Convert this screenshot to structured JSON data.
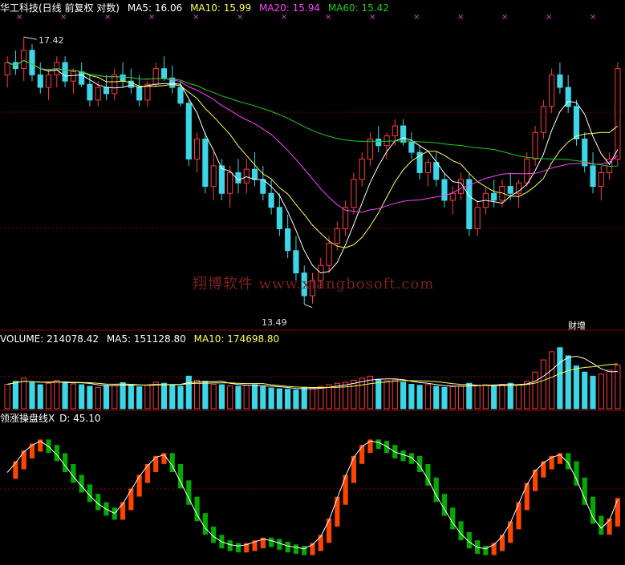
{
  "header": {
    "stock_label": "华工科技(日线 前复权 对数)",
    "ma5": "MA5: 16.06",
    "ma10": "MA10: 15.99",
    "ma20": "MA20: 15.94",
    "ma60": "MA60: 15.42"
  },
  "price_annotations": {
    "high": "17.42",
    "low": "13.49",
    "event_tag": "财增"
  },
  "volume_header": {
    "volume": "VOLUME: 214078.42",
    "ma5": "MA5: 151128.80",
    "ma10": "MA10: 174698.80"
  },
  "indicator_header": {
    "name": "领涨操盘线X",
    "d": "D: 45.10"
  },
  "watermark": "翔博软件 www.xiangbosoft.com",
  "colors": {
    "up": "#ff3c3c",
    "down": "#3cd6e6",
    "ma5": "#ffffff",
    "ma10": "#ffff55",
    "ma20": "#ff44ff",
    "ma60": "#22cc22",
    "grid": "#8b0000",
    "marker": "#dd44dd",
    "osc_up": "#ff4400",
    "osc_down": "#00aa00",
    "osc_line": "#ffffff"
  },
  "chart_data": [
    {
      "type": "candlestick",
      "title": "华工科技(日线 前复权 对数)",
      "scale": "log",
      "y_range": [
        13.2,
        17.8
      ],
      "candles": [
        [
          16.8,
          17.1,
          16.6,
          17.0
        ],
        [
          17.0,
          17.2,
          16.8,
          16.9
        ],
        [
          16.9,
          17.42,
          16.7,
          17.2
        ],
        [
          17.2,
          17.3,
          16.7,
          16.8
        ],
        [
          16.8,
          17.0,
          16.5,
          16.6
        ],
        [
          16.6,
          16.9,
          16.4,
          16.8
        ],
        [
          16.8,
          17.1,
          16.6,
          17.0
        ],
        [
          17.0,
          17.1,
          16.6,
          16.7
        ],
        [
          16.7,
          16.9,
          16.5,
          16.85
        ],
        [
          16.85,
          17.0,
          16.6,
          16.65
        ],
        [
          16.65,
          16.8,
          16.3,
          16.4
        ],
        [
          16.4,
          16.7,
          16.3,
          16.6
        ],
        [
          16.6,
          16.8,
          16.4,
          16.5
        ],
        [
          16.5,
          16.9,
          16.4,
          16.8
        ],
        [
          16.8,
          17.0,
          16.6,
          16.7
        ],
        [
          16.7,
          16.9,
          16.5,
          16.6
        ],
        [
          16.6,
          16.8,
          16.3,
          16.4
        ],
        [
          16.4,
          16.7,
          16.3,
          16.65
        ],
        [
          16.65,
          17.0,
          16.6,
          16.9
        ],
        [
          16.9,
          17.1,
          16.7,
          16.75
        ],
        [
          16.75,
          16.95,
          16.5,
          16.6
        ],
        [
          16.6,
          16.7,
          16.3,
          16.35
        ],
        [
          16.35,
          16.4,
          15.4,
          15.5
        ],
        [
          15.5,
          15.9,
          15.3,
          15.8
        ],
        [
          15.8,
          15.9,
          15.0,
          15.1
        ],
        [
          15.1,
          15.6,
          14.9,
          15.4
        ],
        [
          15.4,
          15.5,
          14.9,
          15.0
        ],
        [
          15.0,
          15.4,
          14.8,
          15.3
        ],
        [
          15.3,
          15.5,
          15.0,
          15.15
        ],
        [
          15.15,
          15.5,
          15.0,
          15.35
        ],
        [
          15.35,
          15.6,
          15.1,
          15.2
        ],
        [
          15.2,
          15.4,
          14.9,
          15.0
        ],
        [
          15.0,
          15.2,
          14.7,
          14.8
        ],
        [
          14.8,
          15.0,
          14.4,
          14.5
        ],
        [
          14.5,
          14.7,
          14.1,
          14.2
        ],
        [
          14.2,
          14.4,
          13.8,
          13.9
        ],
        [
          13.9,
          14.0,
          13.49,
          13.6
        ],
        [
          13.6,
          13.9,
          13.5,
          13.8
        ],
        [
          13.8,
          14.1,
          13.7,
          14.0
        ],
        [
          14.0,
          14.4,
          13.9,
          14.3
        ],
        [
          14.3,
          14.6,
          14.2,
          14.5
        ],
        [
          14.5,
          14.9,
          14.4,
          14.8
        ],
        [
          14.8,
          15.3,
          14.7,
          15.2
        ],
        [
          15.2,
          15.6,
          15.1,
          15.5
        ],
        [
          15.5,
          15.9,
          15.4,
          15.8
        ],
        [
          15.8,
          16.0,
          15.6,
          15.7
        ],
        [
          15.7,
          15.9,
          15.5,
          15.85
        ],
        [
          15.85,
          16.1,
          15.7,
          16.0
        ],
        [
          16.0,
          16.1,
          15.7,
          15.75
        ],
        [
          15.75,
          15.9,
          15.5,
          15.6
        ],
        [
          15.6,
          15.7,
          15.2,
          15.3
        ],
        [
          15.3,
          15.5,
          15.1,
          15.45
        ],
        [
          15.45,
          15.6,
          15.1,
          15.2
        ],
        [
          15.2,
          15.3,
          14.8,
          14.9
        ],
        [
          14.9,
          15.1,
          14.7,
          15.0
        ],
        [
          15.0,
          15.3,
          14.9,
          15.2
        ],
        [
          15.2,
          15.3,
          14.4,
          14.5
        ],
        [
          14.5,
          14.9,
          14.4,
          14.8
        ],
        [
          14.8,
          15.1,
          14.7,
          15.0
        ],
        [
          15.0,
          15.2,
          14.8,
          14.9
        ],
        [
          14.9,
          15.2,
          14.8,
          15.1
        ],
        [
          15.1,
          15.3,
          14.9,
          15.0
        ],
        [
          15.0,
          15.2,
          14.8,
          15.15
        ],
        [
          15.15,
          15.6,
          15.1,
          15.5
        ],
        [
          15.5,
          16.0,
          15.4,
          15.9
        ],
        [
          15.9,
          16.4,
          15.8,
          16.3
        ],
        [
          16.3,
          16.9,
          16.2,
          16.8
        ],
        [
          16.8,
          17.0,
          16.5,
          16.6
        ],
        [
          16.6,
          16.8,
          16.2,
          16.3
        ],
        [
          16.3,
          16.4,
          15.7,
          15.8
        ],
        [
          15.8,
          15.9,
          15.3,
          15.4
        ],
        [
          15.4,
          15.6,
          15.0,
          15.1
        ],
        [
          15.1,
          15.4,
          14.9,
          15.3
        ],
        [
          15.3,
          15.6,
          15.2,
          15.5
        ],
        [
          15.5,
          17.0,
          15.4,
          16.9
        ]
      ]
    },
    {
      "type": "bar",
      "title": "VOLUME",
      "values": [
        120000,
        135000,
        150000,
        128000,
        118000,
        125000,
        140000,
        132000,
        122000,
        118000,
        110000,
        105000,
        115000,
        120000,
        128000,
        112000,
        108000,
        116000,
        130000,
        125000,
        118000,
        110000,
        160000,
        140000,
        135000,
        120000,
        118000,
        112000,
        110000,
        115000,
        118000,
        108000,
        102000,
        98000,
        96000,
        92000,
        105000,
        100000,
        110000,
        118000,
        125000,
        130000,
        140000,
        150000,
        160000,
        145000,
        138000,
        142000,
        130000,
        120000,
        115000,
        118000,
        110000,
        105000,
        108000,
        112000,
        125000,
        115000,
        118000,
        112000,
        120000,
        125000,
        118000,
        135000,
        180000,
        240000,
        280000,
        300000,
        260000,
        210000,
        180000,
        160000,
        170000,
        190000,
        214078.42
      ],
      "up": [
        true,
        false,
        true,
        false,
        false,
        true,
        true,
        false,
        true,
        false,
        false,
        true,
        false,
        true,
        false,
        false,
        false,
        true,
        true,
        false,
        false,
        false,
        false,
        true,
        false,
        true,
        false,
        true,
        false,
        true,
        false,
        false,
        false,
        false,
        false,
        false,
        false,
        true,
        true,
        true,
        true,
        true,
        true,
        true,
        true,
        false,
        true,
        true,
        false,
        false,
        false,
        true,
        false,
        false,
        true,
        true,
        false,
        true,
        true,
        false,
        true,
        false,
        true,
        true,
        true,
        true,
        true,
        false,
        false,
        false,
        false,
        false,
        true,
        true,
        true
      ]
    },
    {
      "type": "line",
      "title": "领涨操盘线X",
      "y_range": [
        0,
        100
      ],
      "values": [
        65,
        72,
        80,
        85,
        88,
        84,
        78,
        70,
        62,
        55,
        48,
        42,
        38,
        35,
        42,
        52,
        62,
        70,
        76,
        78,
        70,
        58,
        46,
        34,
        24,
        18,
        14,
        12,
        11,
        12,
        14,
        16,
        15,
        13,
        11,
        10,
        9,
        12,
        18,
        30,
        46,
        62,
        76,
        84,
        88,
        87,
        84,
        80,
        78,
        76,
        70,
        60,
        48,
        38,
        28,
        20,
        14,
        10,
        9,
        12,
        18,
        28,
        42,
        56,
        66,
        72,
        76,
        78,
        72,
        60,
        46,
        32,
        24,
        30,
        45.1
      ]
    }
  ]
}
